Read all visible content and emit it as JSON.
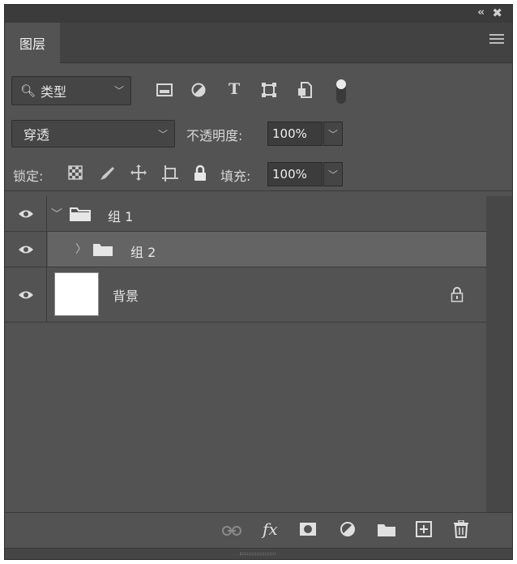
{
  "panel": {
    "tab_label": "图层",
    "collapse_glyph": "‹‹",
    "close_glyph": "✖"
  },
  "filter": {
    "kind_label": "类型",
    "icons": [
      "image-filter-icon",
      "adjustment-filter-icon",
      "type-filter-icon",
      "shape-filter-icon",
      "smart-object-filter-icon",
      "filter-toggle-icon"
    ]
  },
  "blend": {
    "mode": "穿透",
    "opacity_label": "不透明度:",
    "opacity_value": "100%"
  },
  "lock": {
    "label": "锁定:",
    "fill_label": "填充:",
    "fill_value": "100%",
    "icons": [
      "lock-transparent-pixels-icon",
      "lock-image-pixels-icon",
      "lock-position-icon",
      "lock-artboard-icon",
      "lock-all-icon"
    ]
  },
  "layers": [
    {
      "name": "组 1",
      "type": "group",
      "expanded": true,
      "selected": false,
      "visible": true
    },
    {
      "name": "组 2",
      "type": "group",
      "expanded": false,
      "selected": true,
      "visible": true
    },
    {
      "name": "背景",
      "type": "pixel",
      "locked": true,
      "selected": false,
      "visible": true
    }
  ],
  "bottom_bar": {
    "icons": [
      "link-layers-icon",
      "fx-icon",
      "add-mask-icon",
      "new-fill-adjustment-icon",
      "new-group-icon",
      "new-layer-icon",
      "delete-layer-icon"
    ],
    "fx_label": "fx"
  }
}
